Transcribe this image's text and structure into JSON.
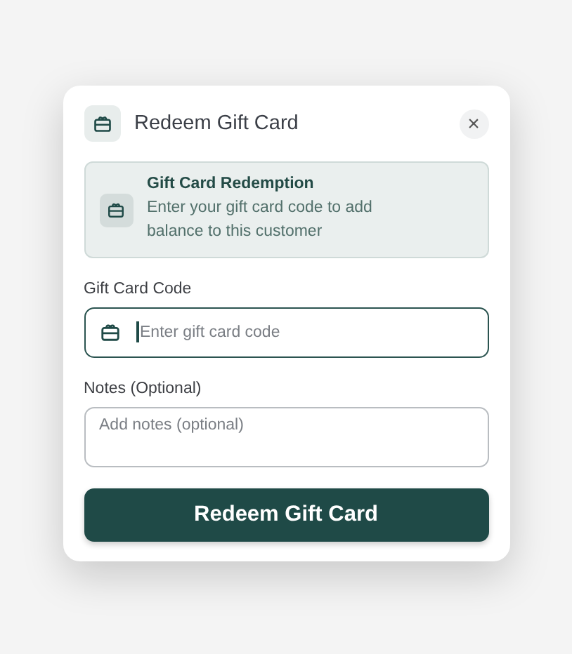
{
  "dialog": {
    "title": "Redeem Gift Card",
    "close": "×"
  },
  "info": {
    "title": "Gift Card Redemption",
    "text": "Enter your gift card code to add balance to this customer"
  },
  "fields": [
    {
      "kind": "input",
      "label": "Gift Card Code",
      "placeholder": "Enter gift card code",
      "focused": true
    },
    {
      "kind": "textarea",
      "label": "Notes (Optional)",
      "placeholder": "Add notes (optional)",
      "focused": false
    }
  ],
  "submit": "Redeem Gift Card"
}
